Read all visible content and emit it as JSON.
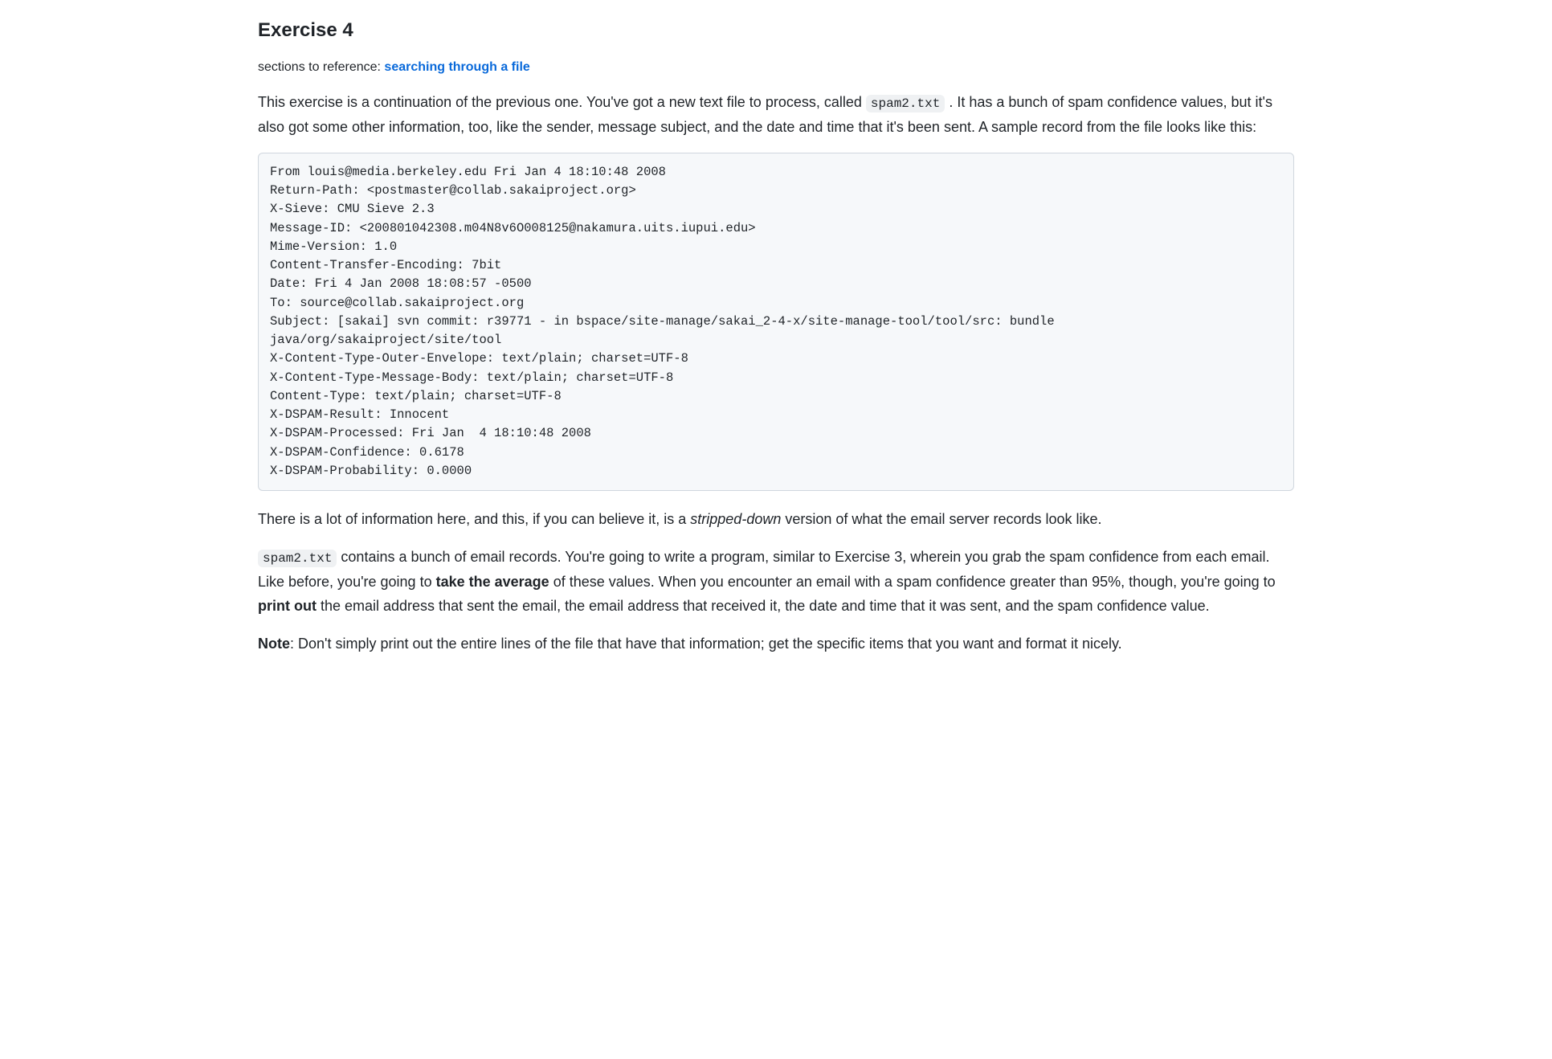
{
  "heading": "Exercise 4",
  "ref_prefix": "sections to reference: ",
  "ref_link_text": "searching through a file",
  "intro": {
    "part1": "This exercise is a continuation of the previous one. You've got a new text file to process, called ",
    "code1": "spam2.txt",
    "part2": " . It has a bunch of spam confidence values, but it's also got some other information, too, like the sender, message subject, and the date and time that it's been sent. A sample record from the file looks like this:"
  },
  "code_block": "From louis@media.berkeley.edu Fri Jan 4 18:10:48 2008\nReturn-Path: <postmaster@collab.sakaiproject.org>\nX-Sieve: CMU Sieve 2.3\nMessage-ID: <200801042308.m04N8v6O008125@nakamura.uits.iupui.edu>\nMime-Version: 1.0\nContent-Transfer-Encoding: 7bit\nDate: Fri 4 Jan 2008 18:08:57 -0500\nTo: source@collab.sakaiproject.org\nSubject: [sakai] svn commit: r39771 - in bspace/site-manage/sakai_2-4-x/site-manage-tool/tool/src: bundle java/org/sakaiproject/site/tool\nX-Content-Type-Outer-Envelope: text/plain; charset=UTF-8\nX-Content-Type-Message-Body: text/plain; charset=UTF-8\nContent-Type: text/plain; charset=UTF-8\nX-DSPAM-Result: Innocent\nX-DSPAM-Processed: Fri Jan  4 18:10:48 2008\nX-DSPAM-Confidence: 0.6178\nX-DSPAM-Probability: 0.0000",
  "after_block": {
    "part1": "There is a lot of information here, and this, if you can believe it, is a ",
    "italic": "stripped-down",
    "part2": " version of what the email server records look like."
  },
  "task": {
    "code1": "spam2.txt",
    "part1": " contains a bunch of email records. You're going to write a program, similar to Exercise 3, wherein you grab the spam confidence from each email. Like before, you're going to ",
    "bold1": "take the average",
    "part2": " of these values. When you encounter an email with a spam confidence greater than 95%, though, you're going to ",
    "bold2": "print out",
    "part3": " the email address that sent the email, the email address that received it, the date and time that it was sent, and the spam confidence value."
  },
  "note": {
    "bold": "Note",
    "rest": ": Don't simply print out the entire lines of the file that have that information; get the specific items that you want and format it nicely."
  }
}
